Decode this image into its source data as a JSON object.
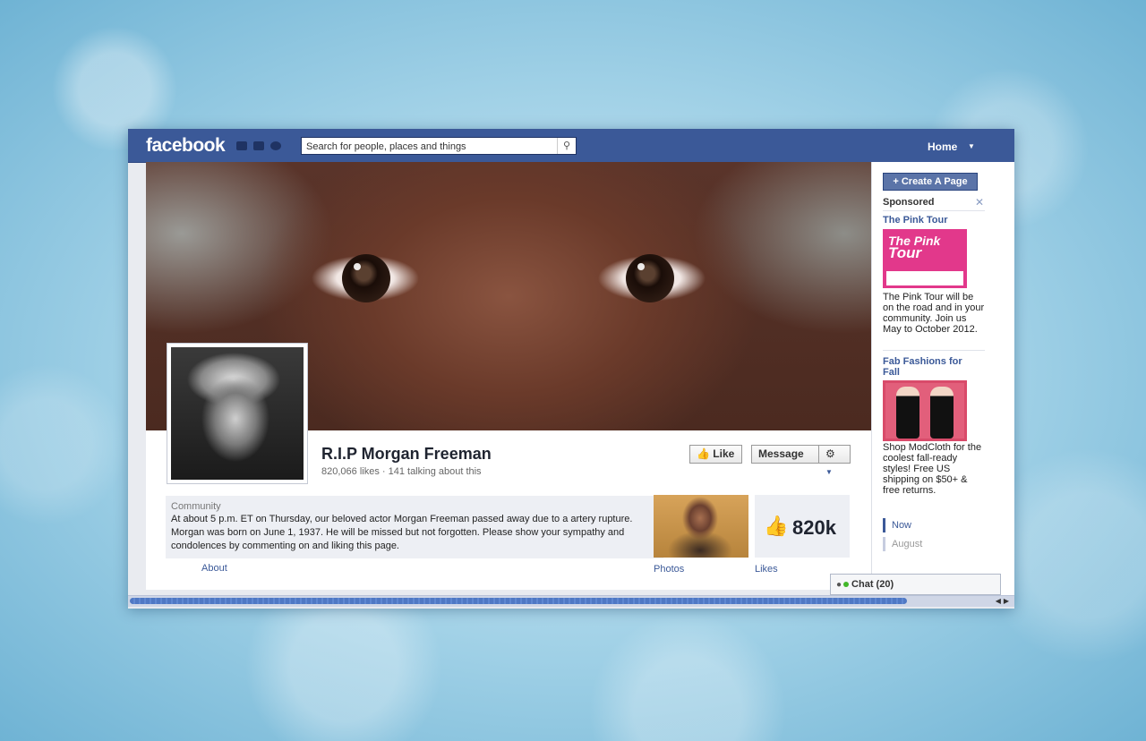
{
  "header": {
    "logo": "facebook",
    "search_placeholder": "Search for people, places and things",
    "home_label": "Home"
  },
  "page": {
    "name": "R.I.P Morgan Freeman",
    "stats": "820,066 likes · 141 talking about this",
    "like_label": "Like",
    "message_label": "Message"
  },
  "about": {
    "category": "Community",
    "description": "At about 5 p.m. ET on Thursday, our beloved actor Morgan Freeman passed away due to a artery rupture. Morgan was born on June 1, 1937. He will be missed but not forgotten. Please show your sympathy and condolences by commenting on and liking this page.",
    "link_label": "About"
  },
  "thumbnails": {
    "photos_label": "Photos",
    "likes_label": "Likes",
    "likes_count": "820k"
  },
  "sidebar": {
    "create_page_label": "+ Create A Page",
    "sponsored_label": "Sponsored",
    "ads": [
      {
        "title": "The Pink Tour",
        "image_text_1": "The Pink",
        "image_text_2": "Tour",
        "text": "The Pink Tour will be on the road and in your community. Join us May to October 2012."
      },
      {
        "title": "Fab Fashions for Fall",
        "text": "Shop ModCloth for the coolest fall-ready styles! Free US shipping on $50+ & free returns."
      }
    ],
    "timeline": [
      "Now",
      "August"
    ]
  },
  "chat": {
    "label": "Chat (20)"
  },
  "colors": {
    "brand_blue": "#3b5998",
    "pink_ad": "#e2388b"
  }
}
